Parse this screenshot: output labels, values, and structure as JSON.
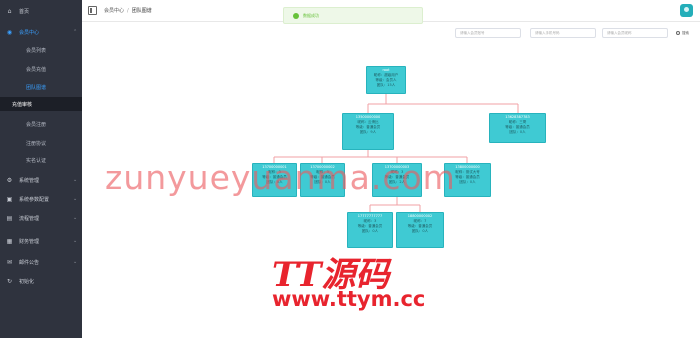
{
  "sidebar": {
    "items": [
      {
        "label": "首页",
        "icon": "home-icon",
        "type": "top"
      },
      {
        "label": "会员中心",
        "icon": "user-icon",
        "type": "top-open"
      },
      {
        "label": "会员列表",
        "type": "sub"
      },
      {
        "label": "会员充值",
        "type": "sub"
      },
      {
        "label": "团队图谱",
        "type": "sub-current"
      },
      {
        "label": "充值审核",
        "type": "sub-active"
      },
      {
        "label": "会员注册",
        "type": "sub"
      },
      {
        "label": "注册协议",
        "type": "sub"
      },
      {
        "label": "实名认证",
        "type": "sub"
      },
      {
        "label": "系统管理",
        "icon": "gear-icon",
        "type": "top"
      },
      {
        "label": "系统参数配置",
        "icon": "settings-icon",
        "type": "top"
      },
      {
        "label": "流程管理",
        "icon": "flow-icon",
        "type": "top"
      },
      {
        "label": "财务管理",
        "icon": "wallet-icon",
        "type": "top"
      },
      {
        "label": "邮件公告",
        "icon": "mail-icon",
        "type": "top"
      },
      {
        "label": "初始化",
        "icon": "reset-icon",
        "type": "top"
      }
    ]
  },
  "header": {
    "breadcrumb": [
      "会员中心",
      "团队图谱"
    ]
  },
  "toast": {
    "message": "数据成功"
  },
  "filters": {
    "placeholders": [
      "请输入会员账号",
      "请输入手机号码",
      "请输入会员昵称"
    ],
    "search_label": "搜索"
  },
  "tree": {
    "nodes": [
      {
        "uid": "root",
        "lines": [
          "昵称：超级用户",
          "等级：会员人",
          "团队：15人"
        ]
      },
      {
        "uid": "13500000000",
        "lines": [
          "昵称：云滑比",
          "等级：普通会员",
          "团队：9人"
        ]
      },
      {
        "uid": "13628387783",
        "lines": [
          "昵称：三哥",
          "等级：普通会员",
          "团队：0人"
        ]
      },
      {
        "uid": "13700000001",
        "lines": [
          "昵称：3",
          "等级：普通会员",
          "团队：0人"
        ]
      },
      {
        "uid": "13700000002",
        "lines": [
          "昵称：3",
          "等级：普通会员",
          "团队：0人"
        ]
      },
      {
        "uid": "13700000003",
        "lines": [
          "昵称：3",
          "等级：普通会员",
          "团队：2人"
        ]
      },
      {
        "uid": "13800000000",
        "lines": [
          "昵称：测试大号",
          "等级：普通会员",
          "团队：0人"
        ]
      },
      {
        "uid": "17777777777",
        "lines": [
          "昵称：3",
          "等级：普通会员",
          "团队：0人"
        ]
      },
      {
        "uid": "18800000002",
        "lines": [
          "昵称：7",
          "等级：普通会员",
          "团队：0人"
        ]
      }
    ]
  },
  "watermark": {
    "domain_text": "zunyueyuanma.com",
    "logo_text": "TT源码",
    "logo_url": "www.ttym.cc"
  },
  "colors": {
    "sidebar_bg": "#2f333e",
    "node_fill": "#3fcad3",
    "connector": "#f0a0a6",
    "accent": "#3aa0ff",
    "success": "#67c23a",
    "watermark": "#e8242e"
  }
}
